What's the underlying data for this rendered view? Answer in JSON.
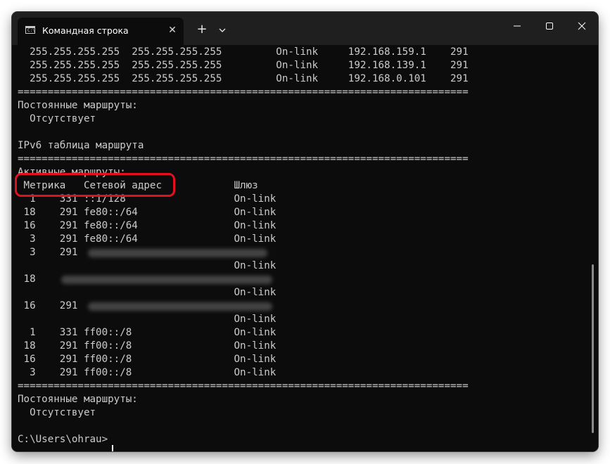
{
  "window": {
    "tab_title": "Командная строка",
    "tab_icon_text": "C:\\",
    "close_tab_glyph": "✕",
    "new_tab_glyph": "+",
    "icons": {
      "tab": "cmd-icon",
      "dropdown": "chevron-down-icon",
      "minimize": "minimize-icon",
      "maximize": "maximize-icon",
      "close": "close-icon"
    }
  },
  "terminal": {
    "lines": [
      "  255.255.255.255  255.255.255.255         On-link     192.168.159.1    291",
      "  255.255.255.255  255.255.255.255         On-link     192.168.139.1    291",
      "  255.255.255.255  255.255.255.255         On-link     192.168.0.101    291",
      "===========================================================================",
      "Постоянные маршруты:",
      "  Отсутствует",
      "",
      "IPv6 таблица маршрута",
      "===========================================================================",
      "Активные маршруты:",
      " Метрика   Сетевой адрес            Шлюз",
      "  1    331 ::1/128                  On-link",
      " 18    291 fe80::/64                On-link",
      " 16    291 fe80::/64                On-link",
      "  3    291 fe80::/64                On-link",
      "  3    291",
      "                                    On-link",
      " 18",
      "                                    On-link",
      " 16    291",
      "                                    On-link",
      "  1    331 ff00::/8                 On-link",
      " 18    291 ff00::/8                 On-link",
      " 16    291 ff00::/8                 On-link",
      "  3    291 ff00::/8                 On-link",
      "===========================================================================",
      "Постоянные маршруты:",
      "  Отсутствует",
      "",
      "C:\\Users\\ohrau>"
    ]
  },
  "colors": {
    "terminal_bg": "#0c0c0c",
    "text": "#cccccc",
    "titlebar_bg": "#1f1f1f",
    "highlight": "#e3101d"
  }
}
